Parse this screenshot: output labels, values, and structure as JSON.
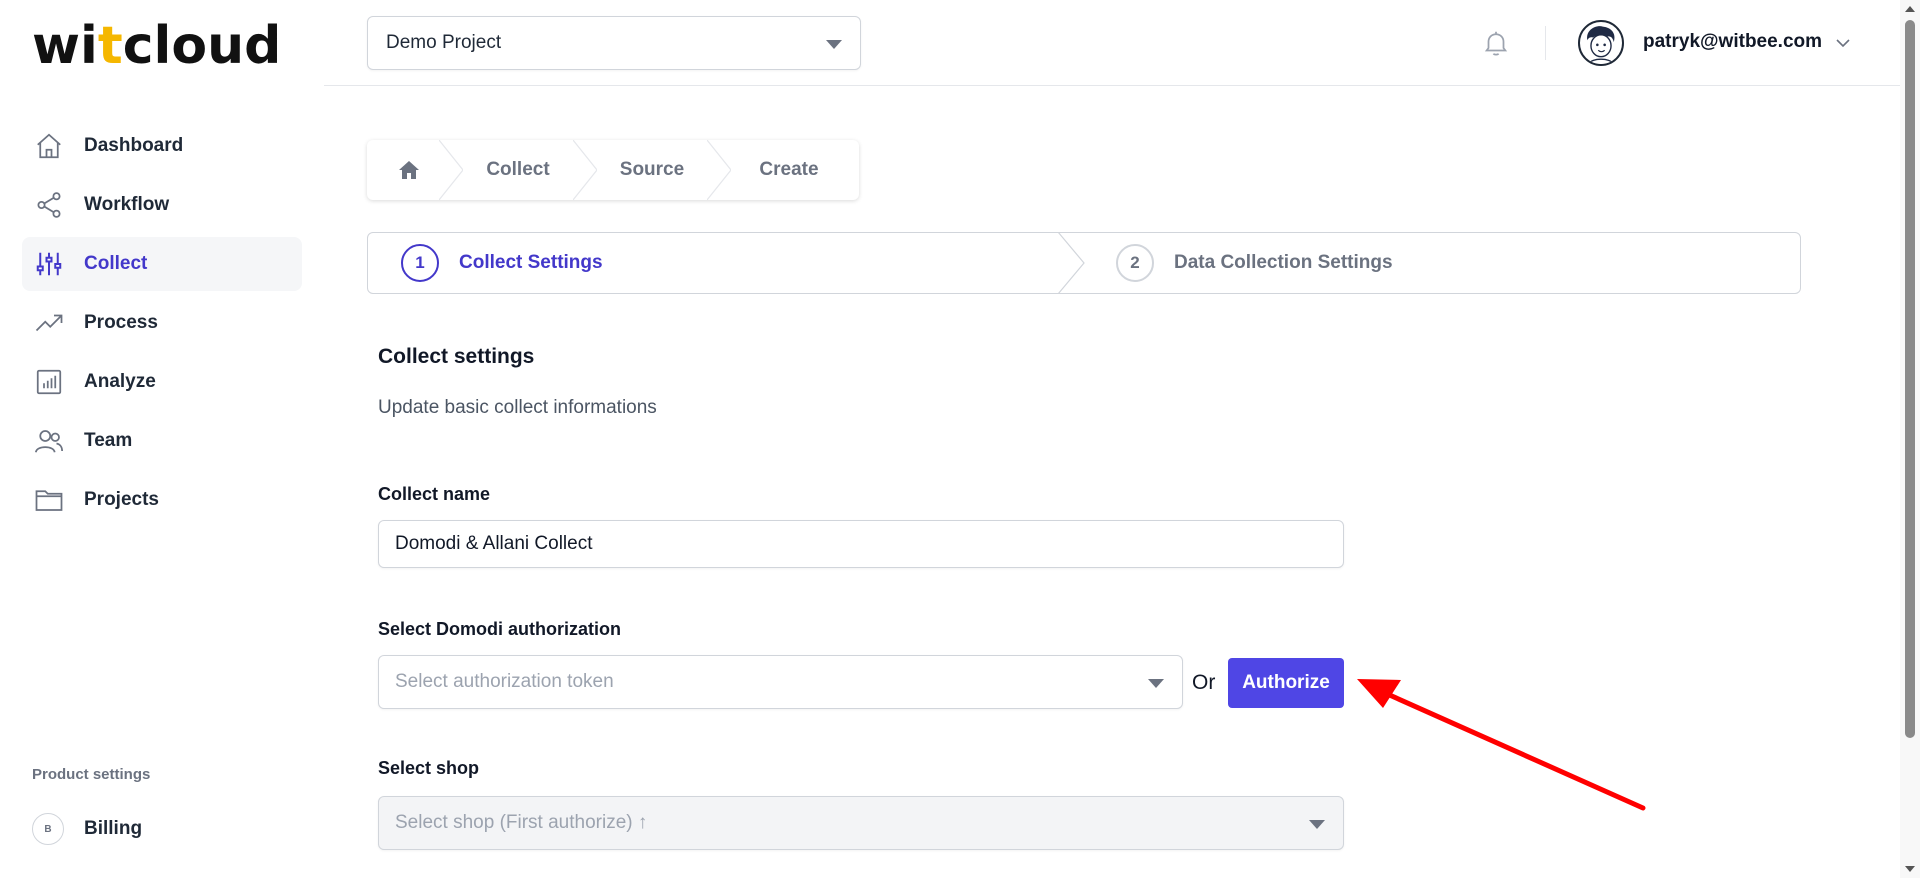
{
  "logo": {
    "part1": "wi",
    "part2": "t",
    "part3": "cloud"
  },
  "sidebar": {
    "items": [
      {
        "label": "Dashboard",
        "icon": "home-icon",
        "active": false
      },
      {
        "label": "Workflow",
        "icon": "share-icon",
        "active": false
      },
      {
        "label": "Collect",
        "icon": "sliders-icon",
        "active": true
      },
      {
        "label": "Process",
        "icon": "trend-icon",
        "active": false
      },
      {
        "label": "Analyze",
        "icon": "chart-icon",
        "active": false
      },
      {
        "label": "Team",
        "icon": "users-icon",
        "active": false
      },
      {
        "label": "Projects",
        "icon": "folder-icon",
        "active": false
      }
    ],
    "section_label": "Product settings",
    "billing": {
      "badge": "B",
      "label": "Billing"
    }
  },
  "topbar": {
    "project": "Demo Project",
    "user_email": "patryk@witbee.com"
  },
  "breadcrumb": {
    "items": [
      "Collect",
      "Source",
      "Create"
    ]
  },
  "stepper": {
    "steps": [
      {
        "number": "1",
        "label": "Collect Settings",
        "active": true
      },
      {
        "number": "2",
        "label": "Data Collection Settings",
        "active": false
      }
    ]
  },
  "form": {
    "title": "Collect settings",
    "subtitle": "Update basic collect informations",
    "name_label": "Collect name",
    "name_value": "Domodi & Allani Collect",
    "auth_label": "Select Domodi authorization",
    "auth_placeholder": "Select authorization token",
    "or_text": "Or",
    "authorize_button": "Authorize",
    "shop_label": "Select shop",
    "shop_placeholder": "Select shop (First authorize) ↑"
  },
  "colors": {
    "accent": "#4f46e5",
    "active_text": "#4338ca",
    "logo_accent": "#f5b700",
    "annotation_arrow": "#ff0000"
  }
}
